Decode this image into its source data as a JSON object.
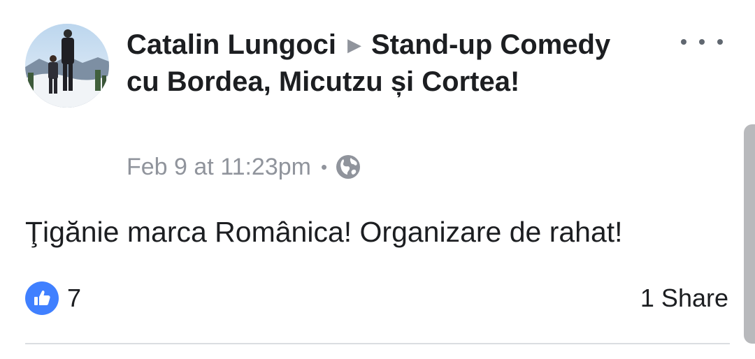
{
  "post": {
    "author": "Catalin Lungoci",
    "separator_icon": "right-triangle-icon",
    "target": "Stand-up Comedy cu Bordea, Micutzu și Cortea!",
    "timestamp": "Feb 9 at 11:23pm",
    "meta_separator": "•",
    "privacy_icon": "globe-icon",
    "message": "Ţigănie marca Românica! Organizare de rahat!",
    "reactions": {
      "icon": "like-icon",
      "count": "7",
      "color": "#4080ff"
    },
    "shares": "1 Share"
  },
  "colors": {
    "text": "#1c1e21",
    "secondary": "#90949c",
    "divider": "#dadde1",
    "scrollbar": "#b8b9bc"
  }
}
